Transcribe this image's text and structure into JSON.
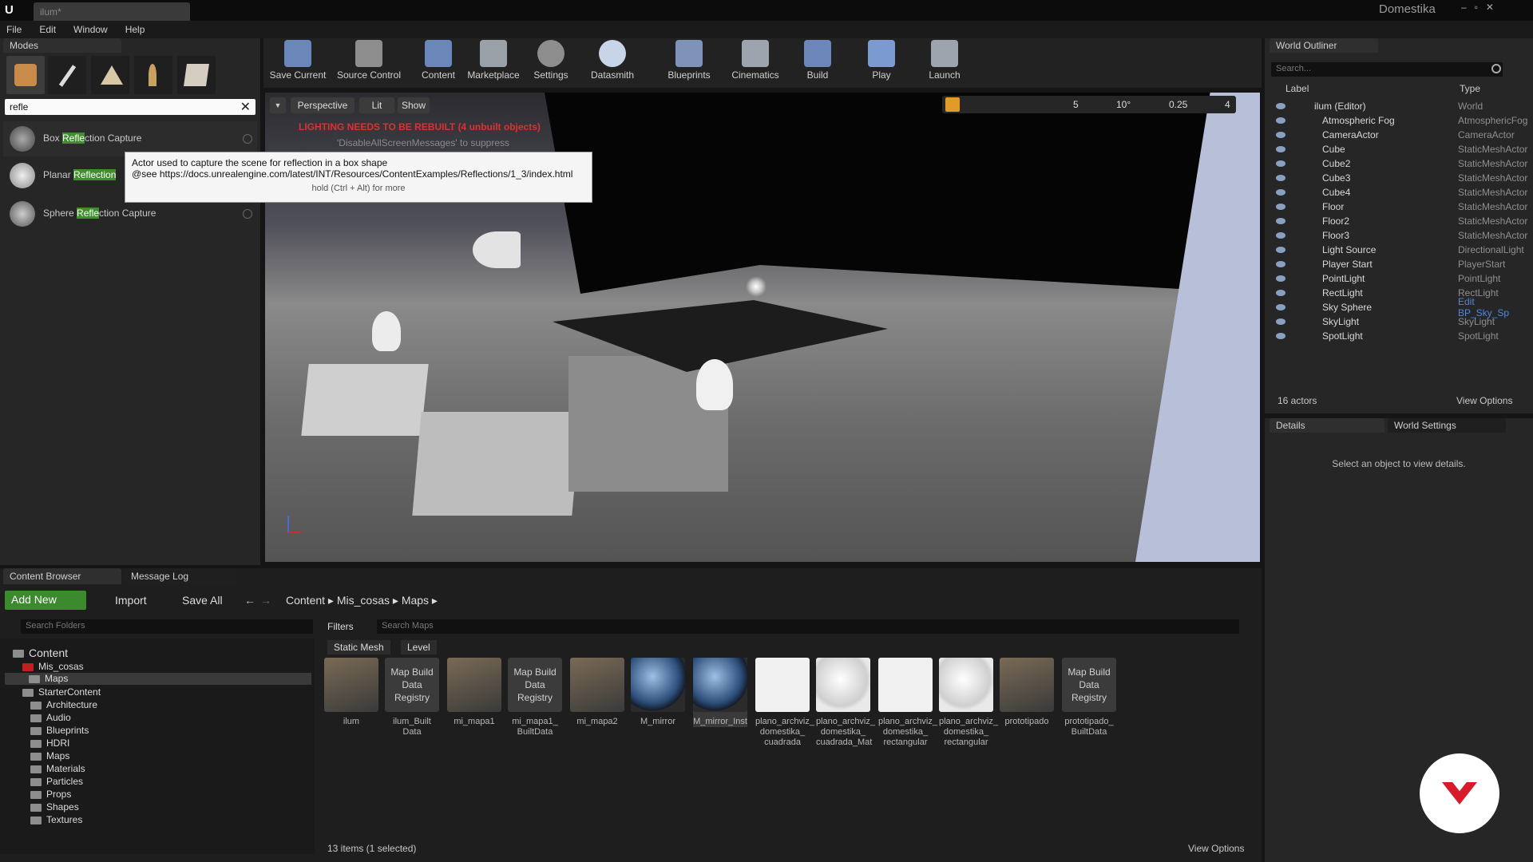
{
  "window": {
    "tab_title": "ilum*",
    "brand": "Domestika"
  },
  "menu": [
    "File",
    "Edit",
    "Window",
    "Help"
  ],
  "modes": {
    "tab": "Modes",
    "search_value": "refle",
    "results": [
      {
        "pre": "Box ",
        "hl": "Refle",
        "post": "ction Capture"
      },
      {
        "pre": "Planar ",
        "hl": "Reflection",
        "post": ""
      },
      {
        "pre": "Sphere ",
        "hl": "Refle",
        "post": "ction Capture"
      }
    ]
  },
  "tooltip": {
    "line1": "Actor used to capture the scene for reflection in a box shape",
    "line2": "@see https://docs.unrealengine.com/latest/INT/Resources/ContentExamples/Reflections/1_3/index.html",
    "line3": "hold (Ctrl + Alt) for more"
  },
  "toolbar": [
    "Save Current",
    "Source Control",
    "Content",
    "Marketplace",
    "Settings",
    "Datasmith",
    "Blueprints",
    "Cinematics",
    "Build",
    "Play",
    "Launch"
  ],
  "viewport": {
    "perspective": "Perspective",
    "lit": "Lit",
    "show": "Show",
    "warning": "LIGHTING NEEDS TO BE REBUILT (4 unbuilt objects)",
    "suppress": "'DisableAllScreenMessages' to suppress",
    "grid": "5",
    "angle": "10°",
    "scale": "0.25",
    "cam": "4"
  },
  "outliner": {
    "tab": "World Outliner",
    "search_placeholder": "Search...",
    "col_label": "Label",
    "col_type": "Type",
    "rows": [
      {
        "label": "ilum (Editor)",
        "type": "World"
      },
      {
        "label": "Atmospheric Fog",
        "type": "AtmosphericFog"
      },
      {
        "label": "CameraActor",
        "type": "CameraActor"
      },
      {
        "label": "Cube",
        "type": "StaticMeshActor"
      },
      {
        "label": "Cube2",
        "type": "StaticMeshActor"
      },
      {
        "label": "Cube3",
        "type": "StaticMeshActor"
      },
      {
        "label": "Cube4",
        "type": "StaticMeshActor"
      },
      {
        "label": "Floor",
        "type": "StaticMeshActor"
      },
      {
        "label": "Floor2",
        "type": "StaticMeshActor"
      },
      {
        "label": "Floor3",
        "type": "StaticMeshActor"
      },
      {
        "label": "Light Source",
        "type": "DirectionalLight"
      },
      {
        "label": "Player Start",
        "type": "PlayerStart"
      },
      {
        "label": "PointLight",
        "type": "PointLight"
      },
      {
        "label": "RectLight",
        "type": "RectLight"
      },
      {
        "label": "Sky Sphere",
        "type": "Edit BP_Sky_Sp"
      },
      {
        "label": "SkyLight",
        "type": "SkyLight"
      },
      {
        "label": "SpotLight",
        "type": "SpotLight"
      }
    ],
    "count": "16 actors",
    "view_options": "View Options"
  },
  "details": {
    "tab": "Details",
    "tab2": "World Settings",
    "empty": "Select an object to view details."
  },
  "content_browser": {
    "tab": "Content Browser",
    "tab2": "Message Log",
    "add_new": "Add New",
    "import": "Import",
    "save_all": "Save All",
    "crumbs": [
      "Content",
      "Mis_cosas",
      "Maps"
    ],
    "search_folders": "Search Folders",
    "filters": "Filters",
    "search_maps": "Search Maps",
    "filter_chips": [
      "Static Mesh",
      "Level"
    ],
    "tree": [
      "Content",
      "Mis_cosas",
      "Maps",
      "StarterContent",
      "Architecture",
      "Audio",
      "Blueprints",
      "HDRI",
      "Maps",
      "Materials",
      "Particles",
      "Props",
      "Shapes",
      "Textures"
    ],
    "assets": [
      {
        "name": "ilum",
        "kind": "mesh",
        "text": ""
      },
      {
        "name": "ilum_Built Data",
        "kind": "reg",
        "text": "Map Build Data Registry"
      },
      {
        "name": "mi_mapa1",
        "kind": "mesh",
        "text": ""
      },
      {
        "name": "mi_mapa1_ BuiltData",
        "kind": "reg",
        "text": "Map Build Data Registry"
      },
      {
        "name": "mi_mapa2",
        "kind": "mesh",
        "text": ""
      },
      {
        "name": "M_mirror",
        "kind": "sphere",
        "text": ""
      },
      {
        "name": "M_mirror_Inst",
        "kind": "sphere",
        "text": ""
      },
      {
        "name": "plano_archviz_ domestika_ cuadrada",
        "kind": "white",
        "text": ""
      },
      {
        "name": "plano_archviz_ domestika_ cuadrada_Mat",
        "kind": "wsphere",
        "text": ""
      },
      {
        "name": "plano_archviz_ domestika_ rectangular",
        "kind": "white",
        "text": ""
      },
      {
        "name": "plano_archviz_ domestika_ rectangular",
        "kind": "wsphere",
        "text": ""
      },
      {
        "name": "prototipado",
        "kind": "mesh",
        "text": ""
      },
      {
        "name": "prototipado_ BuiltData",
        "kind": "reg",
        "text": "Map Build Data Registry"
      }
    ],
    "status": "13 items (1 selected)",
    "view_options": "View Options"
  }
}
